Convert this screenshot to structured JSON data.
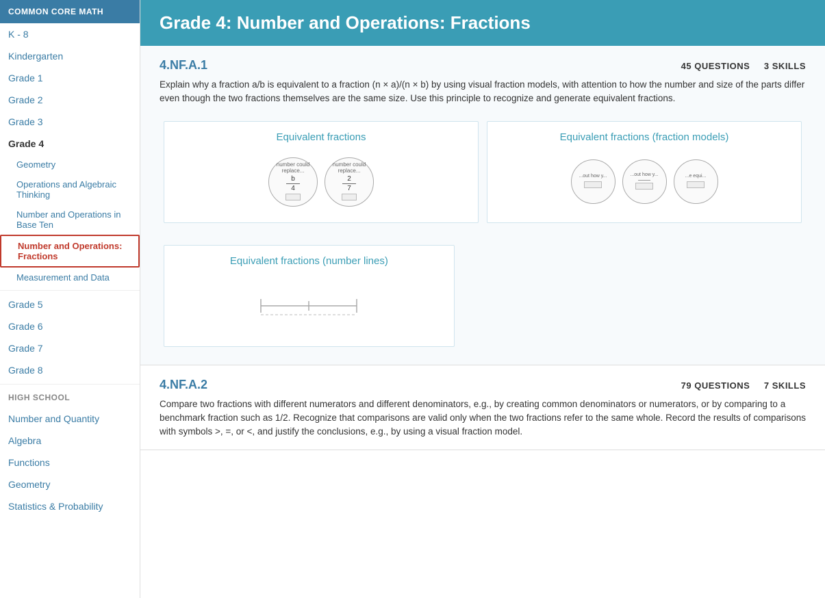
{
  "sidebar": {
    "header": "COMMON CORE MATH",
    "items": [
      {
        "label": "K - 8",
        "type": "section-label",
        "name": "k8"
      },
      {
        "label": "Kindergarten",
        "type": "item",
        "name": "kindergarten"
      },
      {
        "label": "Grade 1",
        "type": "item",
        "name": "grade1"
      },
      {
        "label": "Grade 2",
        "type": "item",
        "name": "grade2"
      },
      {
        "label": "Grade 3",
        "type": "item",
        "name": "grade3"
      },
      {
        "label": "Grade 4",
        "type": "grade-header",
        "name": "grade4"
      },
      {
        "label": "Geometry",
        "type": "sub-item",
        "name": "geometry"
      },
      {
        "label": "Operations and Algebraic Thinking",
        "type": "sub-item",
        "name": "operations-algebraic"
      },
      {
        "label": "Number and Operations in Base Ten",
        "type": "sub-item",
        "name": "number-base-ten"
      },
      {
        "label": "Number and Operations: Fractions",
        "type": "sub-item-active",
        "name": "number-fractions"
      },
      {
        "label": "Measurement and Data",
        "type": "sub-item",
        "name": "measurement-data"
      },
      {
        "label": "Grade 5",
        "type": "item",
        "name": "grade5"
      },
      {
        "label": "Grade 6",
        "type": "item",
        "name": "grade6"
      },
      {
        "label": "Grade 7",
        "type": "item",
        "name": "grade7"
      },
      {
        "label": "Grade 8",
        "type": "item",
        "name": "grade8"
      },
      {
        "label": "HIGH SCHOOL",
        "type": "section-label",
        "name": "high-school"
      },
      {
        "label": "Number and Quantity",
        "type": "item",
        "name": "number-quantity"
      },
      {
        "label": "Algebra",
        "type": "item",
        "name": "algebra"
      },
      {
        "label": "Functions",
        "type": "item",
        "name": "functions"
      },
      {
        "label": "Geometry",
        "type": "item",
        "name": "hs-geometry"
      },
      {
        "label": "Statistics & Probability",
        "type": "item",
        "name": "statistics"
      }
    ]
  },
  "main": {
    "header": "Grade 4: Number and Operations: Fractions",
    "standards": [
      {
        "code": "4.NF.A.1",
        "questions": "45",
        "skills": "3",
        "description": "Explain why a fraction a/b is equivalent to a fraction (n × a)/(n × b) by using visual fraction models, with attention to how the number and size of the parts differ even though the two fractions themselves are the same size. Use this principle to recognize and generate equivalent fractions.",
        "skill_cards": [
          {
            "title": "Equivalent fractions",
            "type": "circles"
          },
          {
            "title": "Equivalent fractions (fraction models)",
            "type": "circles-multi"
          },
          {
            "title": "Equivalent fractions (number lines)",
            "type": "number-lines"
          }
        ]
      },
      {
        "code": "4.NF.A.2",
        "questions": "79",
        "skills": "7",
        "description": "Compare two fractions with different numerators and different denominators, e.g., by creating common denominators or numerators, or by comparing to a benchmark fraction such as 1/2. Recognize that comparisons are valid only when the two fractions refer to the same whole. Record the results of comparisons with symbols >, =, or <, and justify the conclusions, e.g., by using a visual fraction model.",
        "skill_cards": []
      }
    ],
    "labels": {
      "questions": "QUESTIONS",
      "skills": "SKILLS"
    }
  }
}
